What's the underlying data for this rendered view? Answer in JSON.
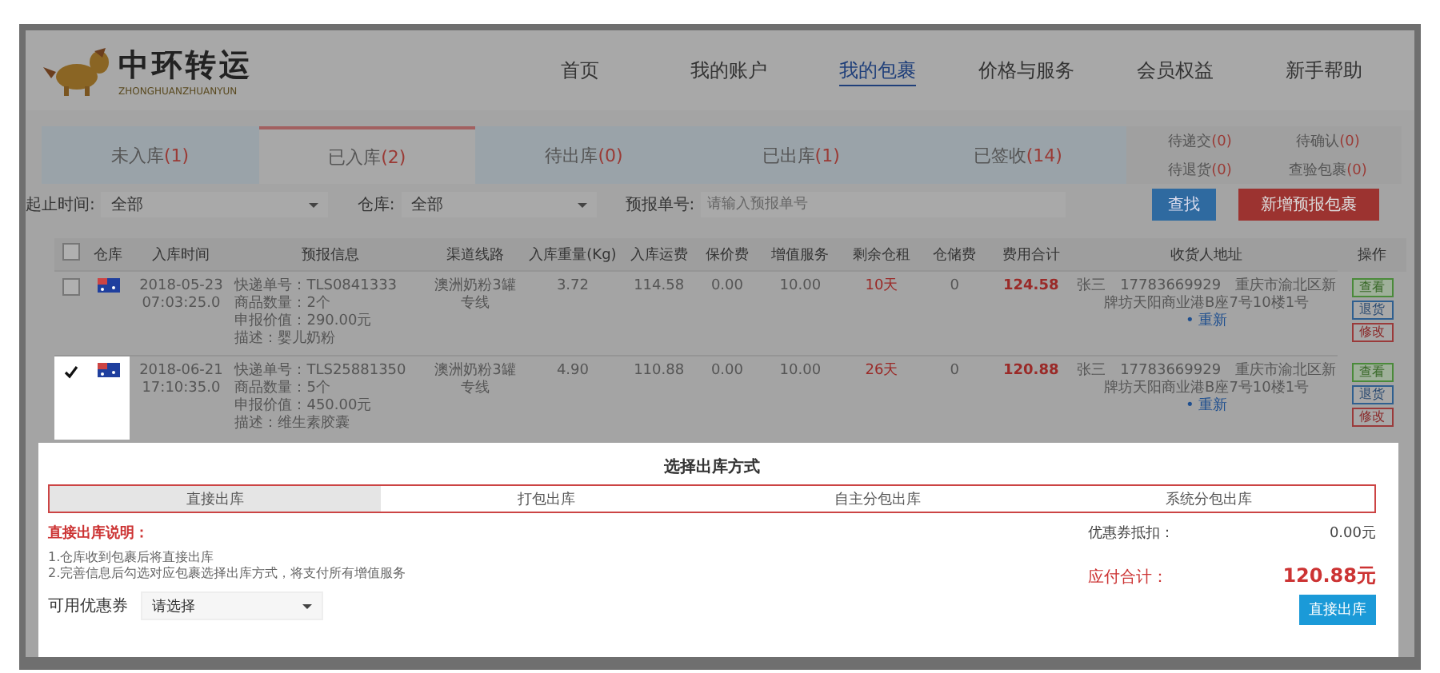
{
  "logo": {
    "name": "中环转运",
    "pinyin": "ZHONGHUANZHUANYUN"
  },
  "nav": [
    {
      "label": "首页",
      "selected": false
    },
    {
      "label": "我的账户",
      "selected": false
    },
    {
      "label": "我的包裹",
      "selected": true
    },
    {
      "label": "价格与服务",
      "selected": false
    },
    {
      "label": "会员权益",
      "selected": false
    },
    {
      "label": "新手帮助",
      "selected": false
    }
  ],
  "tabs": [
    {
      "label": "未入库",
      "count": "(1)",
      "selected": false
    },
    {
      "label": "已入库",
      "count": "(2)",
      "selected": true
    },
    {
      "label": "待出库",
      "count": "(0)",
      "selected": false
    },
    {
      "label": "已出库",
      "count": "(1)",
      "selected": false
    },
    {
      "label": "已签收",
      "count": "(14)",
      "selected": false
    }
  ],
  "counters": [
    {
      "label": "待递交",
      "count": "(0)"
    },
    {
      "label": "待确认",
      "count": "(0)"
    },
    {
      "label": "待退货",
      "count": "(0)"
    },
    {
      "label": "查验包裹",
      "count": "(0)"
    }
  ],
  "filters": {
    "time": {
      "label": "起止时间:",
      "value": "全部"
    },
    "warehouse": {
      "label": "仓库:",
      "value": "全部"
    },
    "forecast": {
      "label": "预报单号:",
      "placeholder": "请输入预报单号"
    },
    "search_button": "查找",
    "add_button": "新增预报包裹"
  },
  "table": {
    "all_checked": false,
    "columns": [
      "仓库",
      "入库时间",
      "预报信息",
      "渠道线路",
      "入库重量(Kg)",
      "入库运费",
      "保价费",
      "增值服务",
      "剩余仓租",
      "仓储费",
      "费用合计",
      "收货人地址",
      "操作"
    ],
    "rows": [
      {
        "checked": false,
        "date": "2018-05-23",
        "time": "07:03:25.0",
        "info": [
          "快递单号：TLS0841333",
          "商品数量：2个",
          "申报价值：290.00元",
          "描述：婴儿奶粉"
        ],
        "channel": "澳洲奶粉3罐专线",
        "weight": "3.72",
        "freight": "114.58",
        "insurance": "0.00",
        "service": "10.00",
        "days": "10天",
        "fee": "0",
        "total": "124.58",
        "address": "张三　17783669929　重庆市渝北区新牌坊天阳商业港B座7号10楼1号",
        "address_action": "• 重新",
        "actions": [
          {
            "kind": "view",
            "label": "查看"
          },
          {
            "kind": "return",
            "label": "退货"
          },
          {
            "kind": "edit",
            "label": "修改"
          }
        ]
      },
      {
        "checked": true,
        "date": "2018-06-21",
        "time": "17:10:35.0",
        "info": [
          "快递单号：TLS25881350",
          "商品数量：5个",
          "申报价值：450.00元",
          "描述：维生素胶囊"
        ],
        "channel": "澳洲奶粉3罐专线",
        "weight": "4.90",
        "freight": "110.88",
        "insurance": "0.00",
        "service": "10.00",
        "days": "26天",
        "fee": "0",
        "total": "120.88",
        "address": "张三　17783669929　重庆市渝北区新牌坊天阳商业港B座7号10楼1号",
        "address_action": "• 重新",
        "actions": [
          {
            "kind": "view",
            "label": "查看"
          },
          {
            "kind": "return",
            "label": "退货"
          },
          {
            "kind": "edit",
            "label": "修改"
          }
        ]
      }
    ]
  },
  "modal": {
    "title": "选择出库方式",
    "methods": [
      {
        "label": "直接出库",
        "selected": true
      },
      {
        "label": "打包出库",
        "selected": false
      },
      {
        "label": "自主分包出库",
        "selected": false
      },
      {
        "label": "系统分包出库",
        "selected": false
      }
    ],
    "note_title": "直接出库说明：",
    "notes": [
      "1.仓库收到包裹后将直接出库",
      "2.完善信息后勾选对应包裹选择出库方式，将支付所有增值服务"
    ],
    "coupon": {
      "label": "可用优惠券",
      "value": "请选择"
    },
    "discount": {
      "label": "优惠券抵扣：",
      "value": "0.00元"
    },
    "total": {
      "label": "应付合计：",
      "value": "120.88元"
    },
    "submit": "直接出库"
  }
}
